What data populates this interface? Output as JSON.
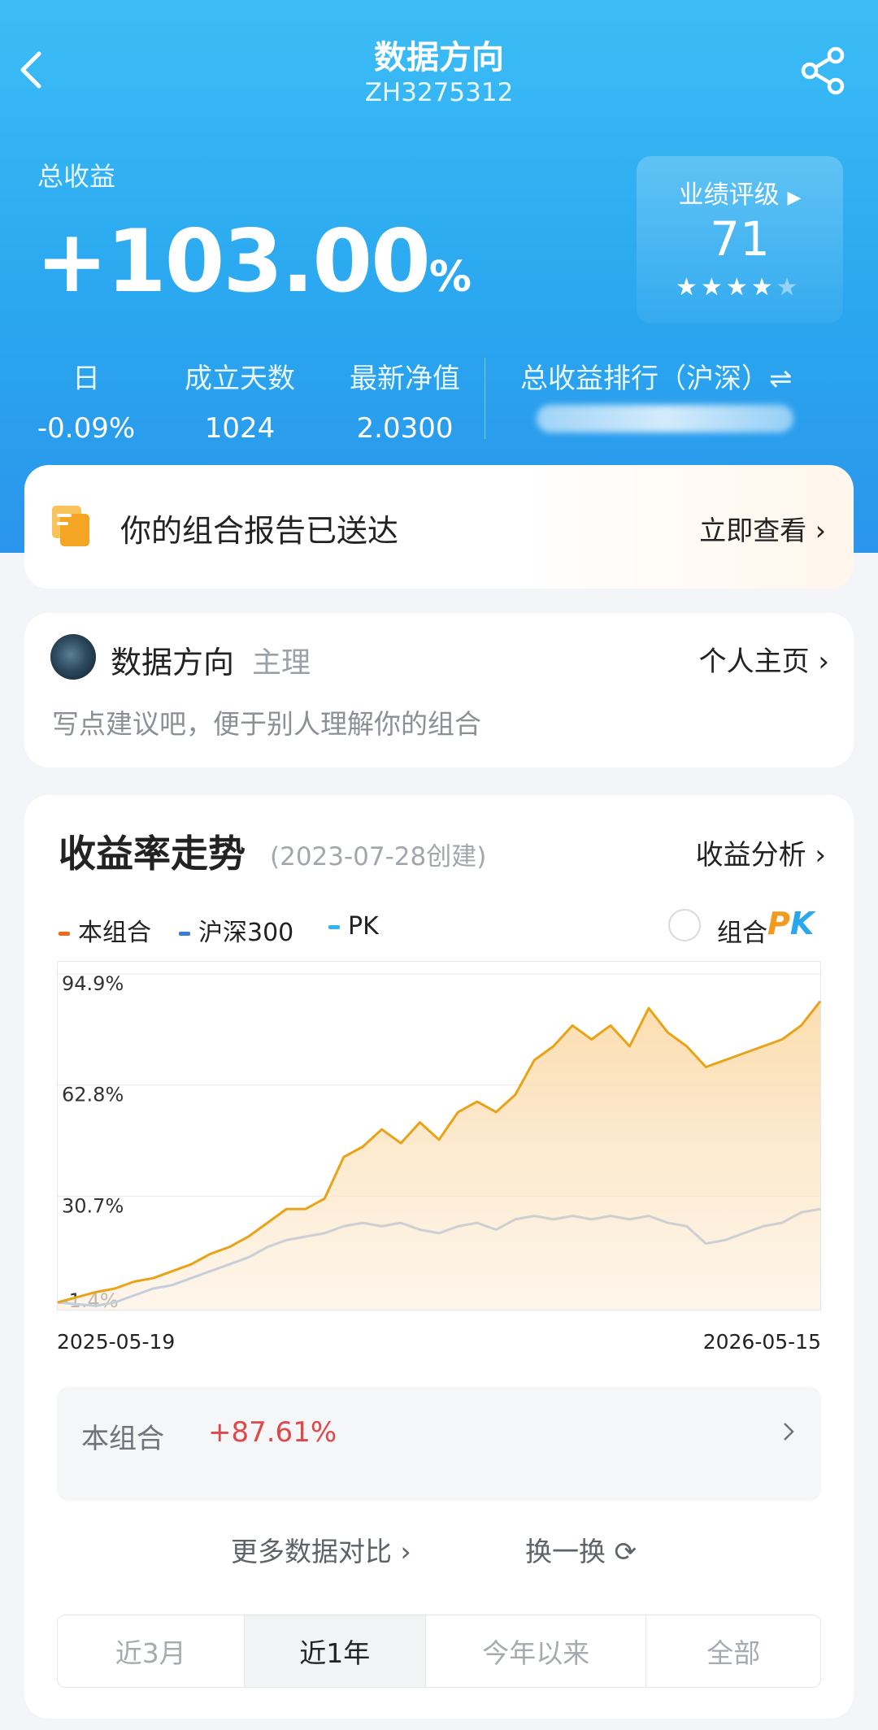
{
  "header": {
    "title": "数据方向",
    "code": "ZH3275312"
  },
  "summary": {
    "total_label": "总收益",
    "total_value": "+103.00",
    "total_suffix": "%",
    "rating_label": "业绩评级",
    "rating_value": "71",
    "rating_stars": 4,
    "rating_max_stars": 5,
    "stats": [
      {
        "label": "日",
        "value": "-0.09%"
      },
      {
        "label": "成立天数",
        "value": "1024"
      },
      {
        "label": "最新净值",
        "value": "2.0300"
      }
    ],
    "rank_label": "总收益排行（沪深）⇌"
  },
  "report": {
    "text": "你的组合报告已送达",
    "link": "立即查看"
  },
  "manager": {
    "name": "数据方向",
    "role": "主理",
    "home_link": "个人主页",
    "note": "写点建议吧，便于别人理解你的组合"
  },
  "trend": {
    "title": "收益率走势",
    "created": "(2023-07-28创建)",
    "analysis_link": "收益分析",
    "pk_toggle_label": "组合",
    "pk_logo_p": "P",
    "pk_logo_k": "K",
    "legend": [
      {
        "name": "本组合",
        "color": "#f06a1e"
      },
      {
        "name": "沪深300",
        "color": "#3a7bd5"
      },
      {
        "name": "PK",
        "color": "#2fb6f0"
      }
    ],
    "summary_label": "本组合",
    "summary_value": "+87.61%",
    "more_compare": "更多数据对比",
    "swap": "换一换",
    "tabs": [
      "近3月",
      "近1年",
      "今年以来",
      "全部"
    ],
    "active_tab": 1
  },
  "chart_data": {
    "type": "area",
    "x_start": "2025-05-19",
    "x_end": "2026-05-15",
    "y_ticks": [
      {
        "value": 94.9,
        "label": "94.9%"
      },
      {
        "value": 62.8,
        "label": "62.8%"
      },
      {
        "value": 30.7,
        "label": "30.7%"
      },
      {
        "value": -1.4,
        "label": "-1.4%"
      }
    ],
    "ylim": [
      -1.4,
      94.9
    ],
    "series": [
      {
        "name": "本组合",
        "color": "#e8a317",
        "values": [
          0,
          1.5,
          3,
          4,
          6,
          7,
          9,
          11,
          14,
          16,
          19,
          23,
          27,
          27,
          30,
          42,
          45,
          50,
          46,
          52,
          47,
          55,
          58,
          55,
          60,
          70,
          74,
          80,
          76,
          80,
          74,
          85,
          78,
          74,
          68,
          70,
          72,
          74,
          76,
          80,
          87
        ]
      },
      {
        "name": "沪深300",
        "color": "#3a7bd5",
        "values": [
          0,
          -0.5,
          -1,
          0,
          2,
          4,
          5,
          7,
          9,
          11,
          13,
          16,
          18,
          19,
          20,
          22,
          23,
          22,
          23,
          21,
          20,
          22,
          23,
          21,
          24,
          25,
          24,
          25,
          24,
          25,
          24,
          25,
          23,
          22,
          17,
          18,
          20,
          22,
          23,
          26,
          27
        ]
      }
    ]
  }
}
